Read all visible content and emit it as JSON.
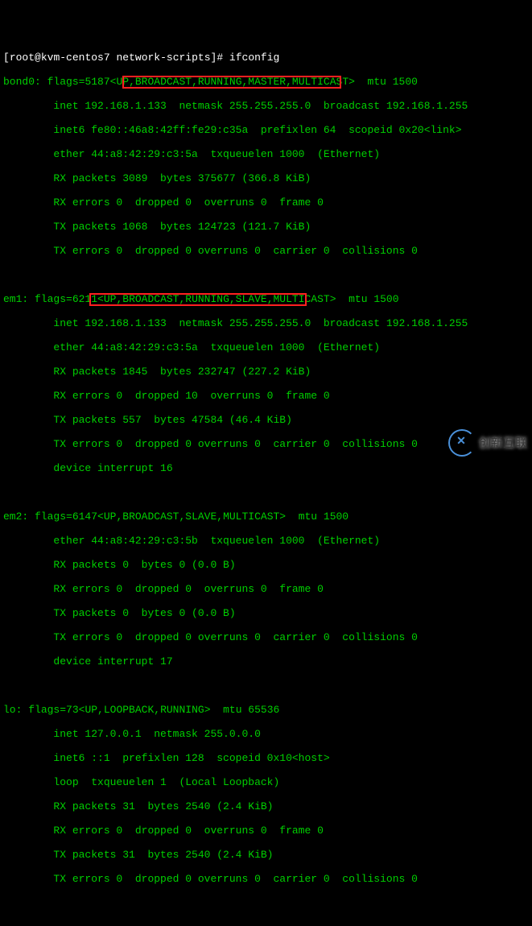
{
  "prompt": {
    "user": "root",
    "host": "kvm-centos7",
    "cwd": "network-scripts",
    "command": "ifconfig"
  },
  "ifaces": [
    {
      "name": "bond0",
      "flagsNum": "5187",
      "flags": "UP,BROADCAST,RUNNING,MASTER,MULTICAST",
      "mtu": "1500",
      "highlightFlags": true,
      "lines": [
        "inet 192.168.1.133  netmask 255.255.255.0  broadcast 192.168.1.255",
        "inet6 fe80::46a8:42ff:fe29:c35a  prefixlen 64  scopeid 0x20<link>",
        "ether 44:a8:42:29:c3:5a  txqueuelen 1000  (Ethernet)",
        "RX packets 3089  bytes 375677 (366.8 KiB)",
        "RX errors 0  dropped 0  overruns 0  frame 0",
        "TX packets 1068  bytes 124723 (121.7 KiB)",
        "TX errors 0  dropped 0 overruns 0  carrier 0  collisions 0"
      ]
    },
    {
      "name": "em1",
      "flagsNum": "6211",
      "flags": "UP,BROADCAST,RUNNING,SLAVE,MULTICAST",
      "mtu": "1500",
      "highlightFlags": true,
      "lines": [
        "inet 192.168.1.133  netmask 255.255.255.0  broadcast 192.168.1.255",
        "ether 44:a8:42:29:c3:5a  txqueuelen 1000  (Ethernet)",
        "RX packets 1845  bytes 232747 (227.2 KiB)",
        "RX errors 0  dropped 10  overruns 0  frame 0",
        "TX packets 557  bytes 47584 (46.4 KiB)",
        "TX errors 0  dropped 0 overruns 0  carrier 0  collisions 0",
        "device interrupt 16"
      ]
    },
    {
      "name": "em2",
      "flagsNum": "6147",
      "flags": "UP,BROADCAST,SLAVE,MULTICAST",
      "mtu": "1500",
      "highlightFlags": false,
      "lines": [
        "ether 44:a8:42:29:c3:5b  txqueuelen 1000  (Ethernet)",
        "RX packets 0  bytes 0 (0.0 B)",
        "RX errors 0  dropped 0  overruns 0  frame 0",
        "TX packets 0  bytes 0 (0.0 B)",
        "TX errors 0  dropped 0 overruns 0  carrier 0  collisions 0",
        "device interrupt 17"
      ]
    },
    {
      "name": "lo",
      "flagsNum": "73",
      "flags": "UP,LOOPBACK,RUNNING",
      "mtu": "65536",
      "highlightFlags": false,
      "lines": [
        "inet 127.0.0.1  netmask 255.0.0.0",
        "inet6 ::1  prefixlen 128  scopeid 0x10<host>",
        "loop  txqueuelen 1  (Local Loopback)",
        "RX packets 31  bytes 2540 (2.4 KiB)",
        "RX errors 0  dropped 0  overruns 0  frame 0",
        "TX packets 31  bytes 2540 (2.4 KiB)",
        "TX errors 0  dropped 0 overruns 0  carrier 0  collisions 0"
      ]
    }
  ],
  "logoText": "创新互联"
}
